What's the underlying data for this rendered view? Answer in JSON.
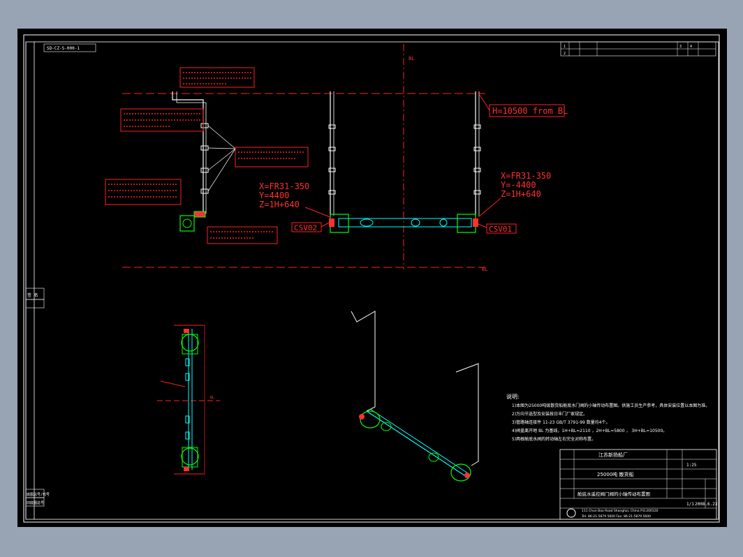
{
  "drawing": {
    "code_tag": "SD-CZ-S-000-1",
    "rev_table": [
      "1",
      "2",
      "3",
      "4"
    ],
    "baseline_label": "BL",
    "left_strip": {
      "label_top": "签 名",
      "label_bottom_1": "底图总号/代号",
      "label_bottom_2": "旧底图总号"
    }
  },
  "callouts": {
    "height": "H=10500 from BL",
    "csv01": "CSV01",
    "csv02": "CSV02",
    "coords_right": [
      "X=FR31-350",
      "Y=-4400",
      "Z=1H+640"
    ],
    "coords_left": [
      "X=FR31-350",
      "Y=4400",
      "Z=1H+640"
    ]
  },
  "notes": {
    "title": "说明:",
    "items": [
      "1)本图为25000吨级散货船舱底水门阀的小轴传动布置图。供施工员生产参考，具体安装位置以本图为准。",
      "2)万向节选型及安装按日丰门厂家规定。",
      "3)管路轴连接件 11-23 GB/T 3791-99 数量均4个。",
      "4)阀盖离开地 BL 为基线，1H+BL=2110 ，2H+BL=5800 ， 3H+BL=10500。",
      "5)两根舱底水阀的转动轴左右完全对称布置。"
    ]
  },
  "title_block": {
    "company": "江苏新扬船厂",
    "project": "25000吨 散货船",
    "drawing_title": "舱底水遥控阀门阀的小轴传动布置图",
    "scale": "1:25",
    "sheet": "1/1",
    "date": "2008.6.23",
    "address": "111 Chun Bao Road Shanghai, China   P.O.200120",
    "phone": "Tel: 86-21-5879 5600   Fax: 86-21-5879 5600"
  },
  "colors": {
    "frame": "#ffffff",
    "annotation": "#ff0000",
    "pipe": "#00ff00",
    "shaft": "#00ffff"
  }
}
